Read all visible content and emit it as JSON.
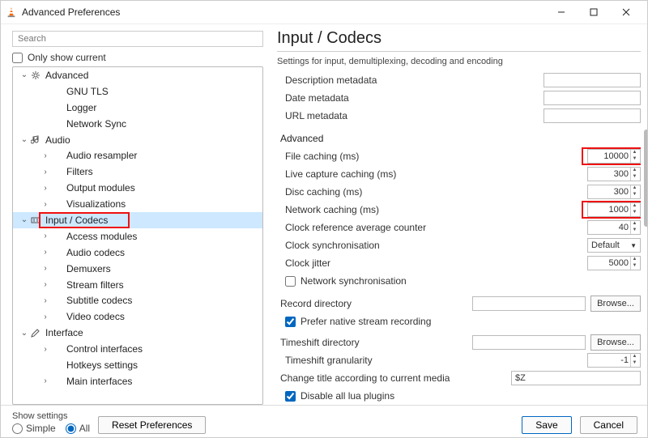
{
  "window": {
    "title": "Advanced Preferences"
  },
  "search": {
    "placeholder": "Search"
  },
  "only_show_current": "Only show current",
  "tree": [
    {
      "depth": 1,
      "chev": "v",
      "icon": "gear",
      "label": "Advanced"
    },
    {
      "depth": 2,
      "chev": "",
      "icon": "",
      "label": "GNU TLS"
    },
    {
      "depth": 2,
      "chev": "",
      "icon": "",
      "label": "Logger"
    },
    {
      "depth": 2,
      "chev": "",
      "icon": "",
      "label": "Network Sync"
    },
    {
      "depth": 1,
      "chev": "v",
      "icon": "note",
      "label": "Audio"
    },
    {
      "depth": 2,
      "chev": ">",
      "icon": "",
      "label": "Audio resampler"
    },
    {
      "depth": 2,
      "chev": ">",
      "icon": "",
      "label": "Filters"
    },
    {
      "depth": 2,
      "chev": ">",
      "icon": "",
      "label": "Output modules"
    },
    {
      "depth": 2,
      "chev": ">",
      "icon": "",
      "label": "Visualizations"
    },
    {
      "depth": 1,
      "chev": "v",
      "icon": "codec",
      "label": "Input / Codecs",
      "sel": true
    },
    {
      "depth": 2,
      "chev": ">",
      "icon": "",
      "label": "Access modules"
    },
    {
      "depth": 2,
      "chev": ">",
      "icon": "",
      "label": "Audio codecs"
    },
    {
      "depth": 2,
      "chev": ">",
      "icon": "",
      "label": "Demuxers"
    },
    {
      "depth": 2,
      "chev": ">",
      "icon": "",
      "label": "Stream filters"
    },
    {
      "depth": 2,
      "chev": ">",
      "icon": "",
      "label": "Subtitle codecs"
    },
    {
      "depth": 2,
      "chev": ">",
      "icon": "",
      "label": "Video codecs"
    },
    {
      "depth": 1,
      "chev": "v",
      "icon": "brush",
      "label": "Interface"
    },
    {
      "depth": 2,
      "chev": ">",
      "icon": "",
      "label": "Control interfaces"
    },
    {
      "depth": 2,
      "chev": "",
      "icon": "",
      "label": "Hotkeys settings"
    },
    {
      "depth": 2,
      "chev": ">",
      "icon": "",
      "label": "Main interfaces"
    }
  ],
  "page": {
    "title": "Input / Codecs",
    "subtitle": "Settings for input, demultiplexing, decoding and encoding",
    "desc_meta": "Description metadata",
    "date_meta": "Date metadata",
    "url_meta": "URL metadata",
    "adv": "Advanced",
    "file_caching": "File caching (ms)",
    "file_caching_v": "10000",
    "live_caching": "Live capture caching (ms)",
    "live_caching_v": "300",
    "disc_caching": "Disc caching (ms)",
    "disc_caching_v": "300",
    "net_caching": "Network caching (ms)",
    "net_caching_v": "1000",
    "clock_ref": "Clock reference average counter",
    "clock_ref_v": "40",
    "clock_sync": "Clock synchronisation",
    "clock_sync_v": "Default",
    "clock_jitter": "Clock jitter",
    "clock_jitter_v": "5000",
    "net_sync": "Network synchronisation",
    "rec_dir": "Record directory",
    "browse": "Browse...",
    "prefer_native": "Prefer native stream recording",
    "ts_dir": "Timeshift directory",
    "ts_gran": "Timeshift granularity",
    "ts_gran_v": "-1",
    "change_title": "Change title according to current media",
    "change_title_v": "$Z",
    "disable_lua": "Disable all lua plugins"
  },
  "footer": {
    "show_settings": "Show settings",
    "simple": "Simple",
    "all": "All",
    "reset": "Reset Preferences",
    "save": "Save",
    "cancel": "Cancel"
  }
}
